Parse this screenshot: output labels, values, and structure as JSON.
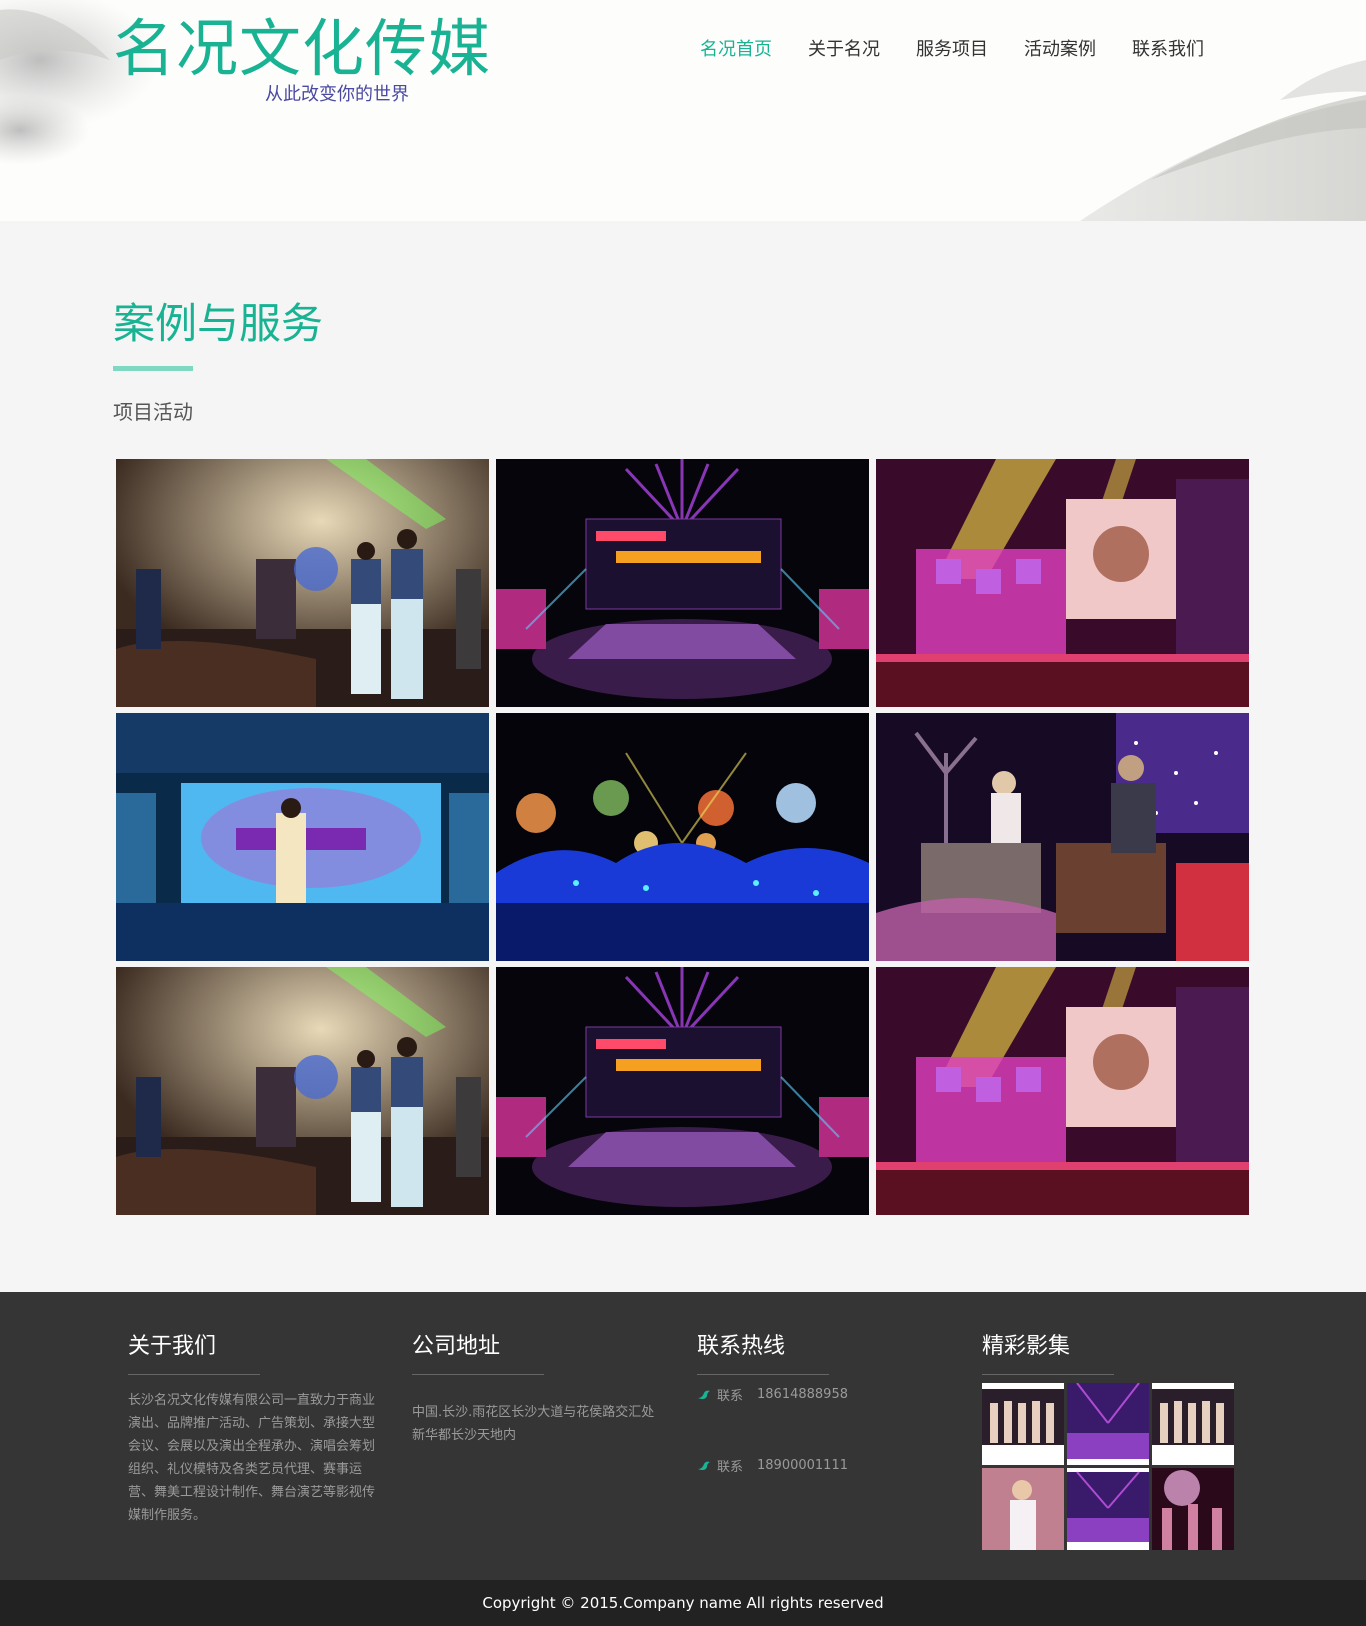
{
  "header": {
    "logo_title": "名况文化传媒",
    "logo_subtitle": "从此改变你的世界",
    "nav": [
      {
        "label": "名况首页",
        "active": true
      },
      {
        "label": "关于名况",
        "active": false
      },
      {
        "label": "服务项目",
        "active": false
      },
      {
        "label": "活动案例",
        "active": false
      },
      {
        "label": "联系我们",
        "active": false
      }
    ]
  },
  "main": {
    "section_title": "案例与服务",
    "section_subtitle": "项目活动",
    "gallery_photos": [
      "performers-receiving-flowers-photo",
      "stage-design-purple-lights-photo",
      "concert-stage-magenta-lights-photo",
      "dancer-on-blue-stage-photo",
      "night-concert-balloons-photo",
      "guqin-performance-photo",
      "performers-receiving-flowers-photo",
      "stage-design-purple-lights-photo",
      "concert-stage-magenta-lights-photo"
    ]
  },
  "footer": {
    "about": {
      "title": "关于我们",
      "text": "长沙名况文化传媒有限公司一直致力于商业演出、品牌推广活动、广告策划、承接大型会议、会展以及演出全程承办、演唱会筹划组织、礼仪模特及各类艺员代理、赛事运营、舞美工程设计制作、舞台演艺等影视传媒制作服务。"
    },
    "address": {
      "title": "公司地址",
      "text": "中国.长沙.雨花区长沙大道与花侯路交汇处新华都长沙天地内"
    },
    "hotline": {
      "title": "联系热线",
      "items": [
        {
          "label": "联系",
          "number": "18614888958"
        },
        {
          "label": "联系",
          "number": "18900001111"
        }
      ]
    },
    "gallery": {
      "title": "精彩影集"
    },
    "copyright": "Copyright © 2015.Company name All rights reserved"
  },
  "colors": {
    "accent": "#19b394",
    "footer_bg": "#353535",
    "copyright_bg": "#222222"
  }
}
